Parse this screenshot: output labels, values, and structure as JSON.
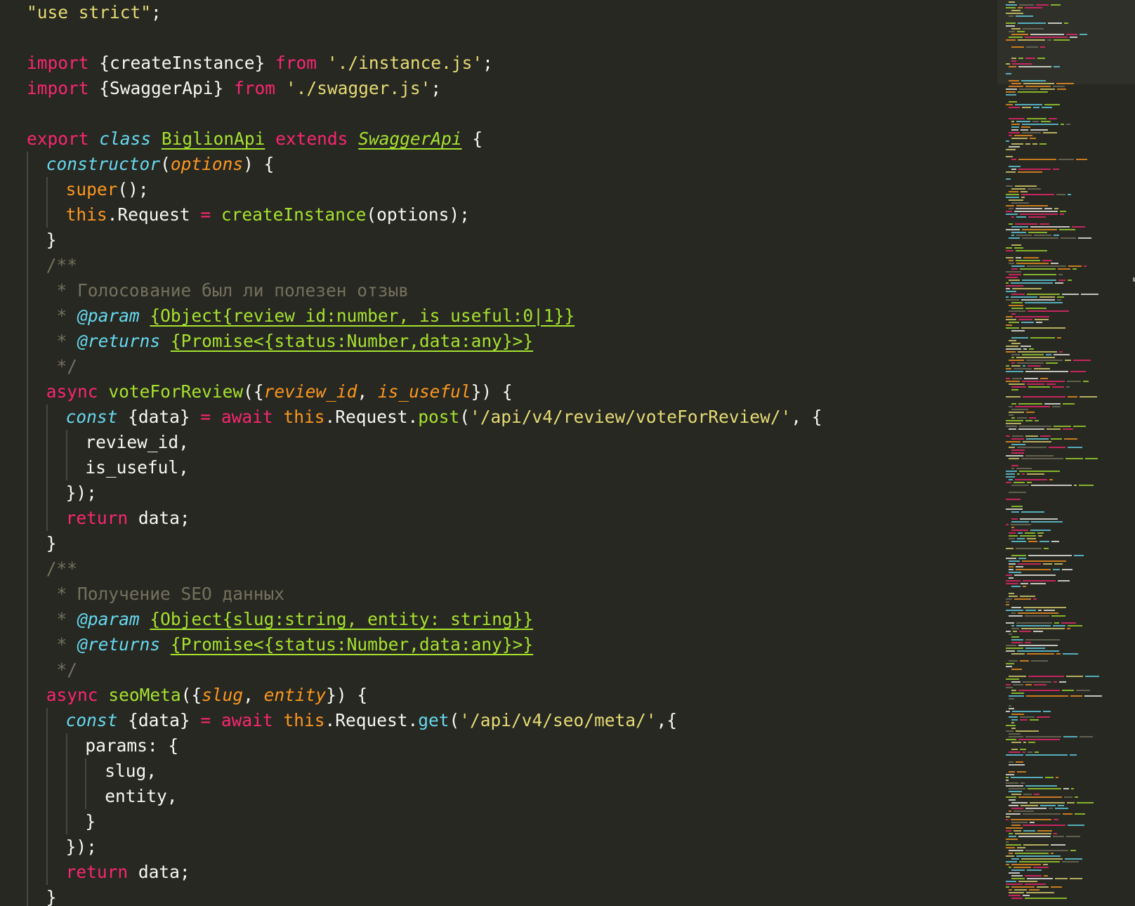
{
  "editor": {
    "theme_colors": {
      "background": "#272822",
      "foreground": "#f8f8f2",
      "keyword": "#f92672",
      "string": "#e6db74",
      "storage": "#66d9ef",
      "entity": "#a6e22e",
      "parameter": "#fd971f",
      "comment": "#75715e"
    },
    "lines": [
      {
        "indent": 0,
        "tokens": [
          [
            "str",
            "\"use strict\""
          ],
          [
            "plain",
            ";"
          ]
        ]
      },
      {
        "indent": 0,
        "tokens": []
      },
      {
        "indent": 0,
        "tokens": [
          [
            "kw",
            "import"
          ],
          [
            "plain",
            " {createInstance} "
          ],
          [
            "kw",
            "from"
          ],
          [
            "plain",
            " "
          ],
          [
            "str",
            "'./instance.js'"
          ],
          [
            "plain",
            ";"
          ]
        ]
      },
      {
        "indent": 0,
        "tokens": [
          [
            "kw",
            "import"
          ],
          [
            "plain",
            " {SwaggerApi} "
          ],
          [
            "kw",
            "from"
          ],
          [
            "plain",
            " "
          ],
          [
            "str",
            "'./swagger.js'"
          ],
          [
            "plain",
            ";"
          ]
        ]
      },
      {
        "indent": 0,
        "tokens": []
      },
      {
        "indent": 0,
        "tokens": [
          [
            "kw",
            "export"
          ],
          [
            "plain",
            " "
          ],
          [
            "storage",
            "class"
          ],
          [
            "plain",
            " "
          ],
          [
            "class",
            "BiglionApi"
          ],
          [
            "plain",
            " "
          ],
          [
            "kw",
            "extends"
          ],
          [
            "plain",
            " "
          ],
          [
            "classi",
            "SwaggerApi"
          ],
          [
            "plain",
            " {"
          ]
        ]
      },
      {
        "indent": 1,
        "tokens": [
          [
            "ctor",
            "constructor"
          ],
          [
            "plain",
            "("
          ],
          [
            "param",
            "options"
          ],
          [
            "plain",
            ") {"
          ]
        ]
      },
      {
        "indent": 2,
        "tokens": [
          [
            "this",
            "super"
          ],
          [
            "plain",
            "();"
          ]
        ]
      },
      {
        "indent": 2,
        "tokens": [
          [
            "this",
            "this"
          ],
          [
            "plain",
            ".Request "
          ],
          [
            "kw",
            "="
          ],
          [
            "plain",
            " "
          ],
          [
            "fn",
            "createInstance"
          ],
          [
            "plain",
            "(options);"
          ]
        ]
      },
      {
        "indent": 1,
        "tokens": [
          [
            "plain",
            "}"
          ]
        ]
      },
      {
        "indent": 1,
        "tokens": [
          [
            "comment",
            "/**"
          ]
        ]
      },
      {
        "indent": 1,
        "tokens": [
          [
            "comment",
            " * Голосование был ли полезен отзыв"
          ]
        ]
      },
      {
        "indent": 1,
        "tokens": [
          [
            "comment",
            " * "
          ],
          [
            "tag",
            "@param"
          ],
          [
            "plain",
            " "
          ],
          [
            "type",
            "{Object{review_id:number, is_useful:0|1}}"
          ]
        ]
      },
      {
        "indent": 1,
        "tokens": [
          [
            "comment",
            " * "
          ],
          [
            "tag",
            "@returns"
          ],
          [
            "plain",
            " "
          ],
          [
            "type",
            "{Promise<{status:Number,data:any}>}"
          ]
        ]
      },
      {
        "indent": 1,
        "tokens": [
          [
            "comment",
            " */"
          ]
        ]
      },
      {
        "indent": 1,
        "tokens": [
          [
            "kw",
            "async"
          ],
          [
            "plain",
            " "
          ],
          [
            "fn",
            "voteForReview"
          ],
          [
            "plain",
            "({"
          ],
          [
            "param",
            "review_id"
          ],
          [
            "plain",
            ", "
          ],
          [
            "param",
            "is_useful"
          ],
          [
            "plain",
            "}) {"
          ]
        ]
      },
      {
        "indent": 2,
        "tokens": [
          [
            "storage",
            "const"
          ],
          [
            "plain",
            " {data} "
          ],
          [
            "kw",
            "="
          ],
          [
            "plain",
            " "
          ],
          [
            "kw",
            "await"
          ],
          [
            "plain",
            " "
          ],
          [
            "this",
            "this"
          ],
          [
            "plain",
            ".Request."
          ],
          [
            "fn",
            "post"
          ],
          [
            "plain",
            "("
          ],
          [
            "str",
            "'/api/v4/review/voteForReview/'"
          ],
          [
            "plain",
            ", {"
          ]
        ]
      },
      {
        "indent": 3,
        "tokens": [
          [
            "plain",
            "review_id,"
          ]
        ]
      },
      {
        "indent": 3,
        "tokens": [
          [
            "plain",
            "is_useful,"
          ]
        ]
      },
      {
        "indent": 2,
        "tokens": [
          [
            "plain",
            "});"
          ]
        ]
      },
      {
        "indent": 2,
        "tokens": [
          [
            "kw",
            "return"
          ],
          [
            "plain",
            " data;"
          ]
        ]
      },
      {
        "indent": 1,
        "tokens": [
          [
            "plain",
            "}"
          ]
        ]
      },
      {
        "indent": 1,
        "tokens": [
          [
            "comment",
            "/**"
          ]
        ]
      },
      {
        "indent": 1,
        "tokens": [
          [
            "comment",
            " * Получение SEO данных"
          ]
        ]
      },
      {
        "indent": 1,
        "tokens": [
          [
            "comment",
            " * "
          ],
          [
            "tag",
            "@param"
          ],
          [
            "plain",
            " "
          ],
          [
            "type",
            "{Object{slug:string, entity: string}}"
          ]
        ]
      },
      {
        "indent": 1,
        "tokens": [
          [
            "comment",
            " * "
          ],
          [
            "tag",
            "@returns"
          ],
          [
            "plain",
            " "
          ],
          [
            "type",
            "{Promise<{status:Number,data:any}>}"
          ]
        ]
      },
      {
        "indent": 1,
        "tokens": [
          [
            "comment",
            " */"
          ]
        ]
      },
      {
        "indent": 1,
        "tokens": [
          [
            "kw",
            "async"
          ],
          [
            "plain",
            " "
          ],
          [
            "fn",
            "seoMeta"
          ],
          [
            "plain",
            "({"
          ],
          [
            "param",
            "slug"
          ],
          [
            "plain",
            ", "
          ],
          [
            "param",
            "entity"
          ],
          [
            "plain",
            "}) {"
          ]
        ]
      },
      {
        "indent": 2,
        "tokens": [
          [
            "storage",
            "const"
          ],
          [
            "plain",
            " {data} "
          ],
          [
            "kw",
            "="
          ],
          [
            "plain",
            " "
          ],
          [
            "kw",
            "await"
          ],
          [
            "plain",
            " "
          ],
          [
            "this",
            "this"
          ],
          [
            "plain",
            ".Request."
          ],
          [
            "method",
            "get"
          ],
          [
            "plain",
            "("
          ],
          [
            "str",
            "'/api/v4/seo/meta/'"
          ],
          [
            "plain",
            ",{"
          ]
        ]
      },
      {
        "indent": 3,
        "tokens": [
          [
            "plain",
            "params: {"
          ]
        ]
      },
      {
        "indent": 4,
        "tokens": [
          [
            "plain",
            "slug,"
          ]
        ]
      },
      {
        "indent": 4,
        "tokens": [
          [
            "plain",
            "entity,"
          ]
        ]
      },
      {
        "indent": 3,
        "tokens": [
          [
            "plain",
            "}"
          ]
        ]
      },
      {
        "indent": 2,
        "tokens": [
          [
            "plain",
            "});"
          ]
        ]
      },
      {
        "indent": 2,
        "tokens": [
          [
            "kw",
            "return"
          ],
          [
            "plain",
            " data;"
          ]
        ]
      },
      {
        "indent": 1,
        "tokens": [
          [
            "plain",
            "}"
          ]
        ]
      }
    ]
  }
}
